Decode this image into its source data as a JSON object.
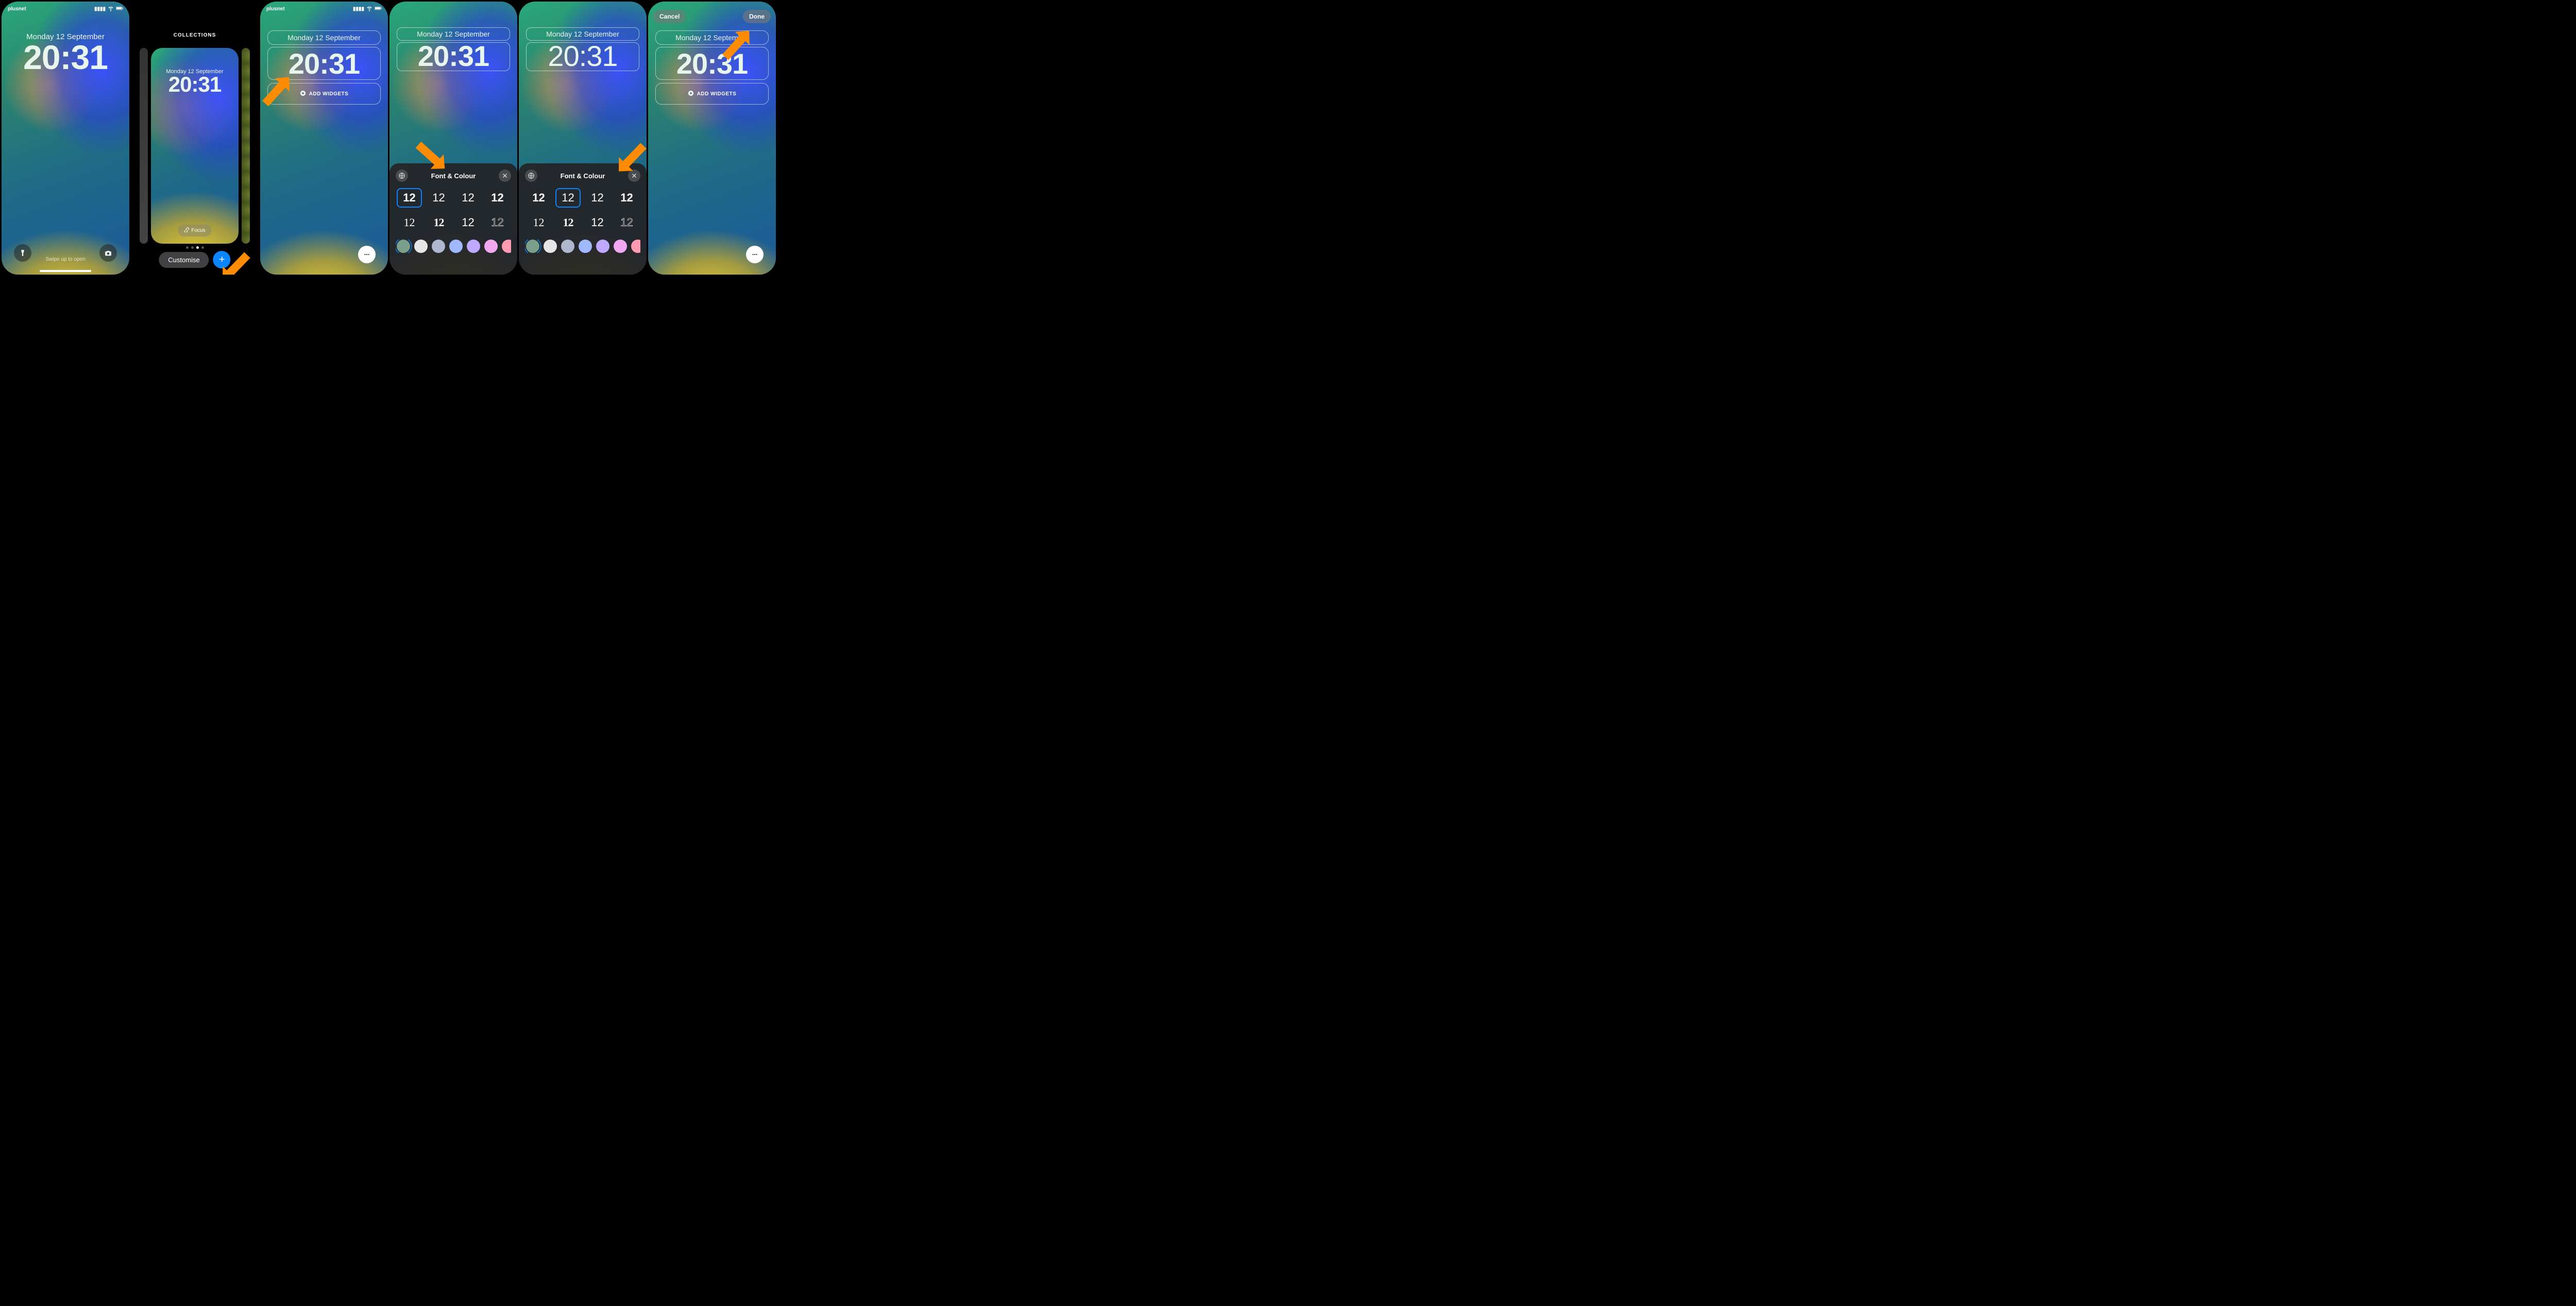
{
  "status": {
    "carrier": "plusnet"
  },
  "lockscreen": {
    "date": "Monday 12 September",
    "time": "20:31",
    "swipe_hint": "Swipe up to open"
  },
  "gallery": {
    "header": "COLLECTIONS",
    "focus_label": "Focus",
    "customise_label": "Customise",
    "page_index": 2,
    "page_count": 4
  },
  "edit": {
    "add_widgets_label": "ADD WIDGETS",
    "cancel_label": "Cancel",
    "done_label": "Done"
  },
  "font_sheet": {
    "title": "Font & Colour",
    "sample": "12",
    "globe_icon": "globe-icon",
    "close_icon": "close-icon",
    "fonts": [
      {
        "id": "heavy",
        "class": "fw-heavy"
      },
      {
        "id": "regular",
        "class": "fw-reg"
      },
      {
        "id": "light",
        "class": "fw-light"
      },
      {
        "id": "outline-bold",
        "class": "fw-slab"
      },
      {
        "id": "serif",
        "class": "fw-serif"
      },
      {
        "id": "serif-bold",
        "class": "fw-serifb"
      },
      {
        "id": "thin",
        "class": "fw-thin"
      },
      {
        "id": "outline",
        "class": "fw-outline"
      }
    ],
    "panel4_selected_font": 0,
    "panel5_selected_font": 1,
    "colors": [
      {
        "hex": "#7aa08c"
      },
      {
        "hex": "#e6e6e6"
      },
      {
        "hex": "#b0b8d0"
      },
      {
        "hex": "#9fb8ff"
      },
      {
        "hex": "#bfa8ff"
      },
      {
        "hex": "#f0a8f0"
      },
      {
        "hex": "#ff9ab0"
      }
    ],
    "selected_color": 0
  }
}
